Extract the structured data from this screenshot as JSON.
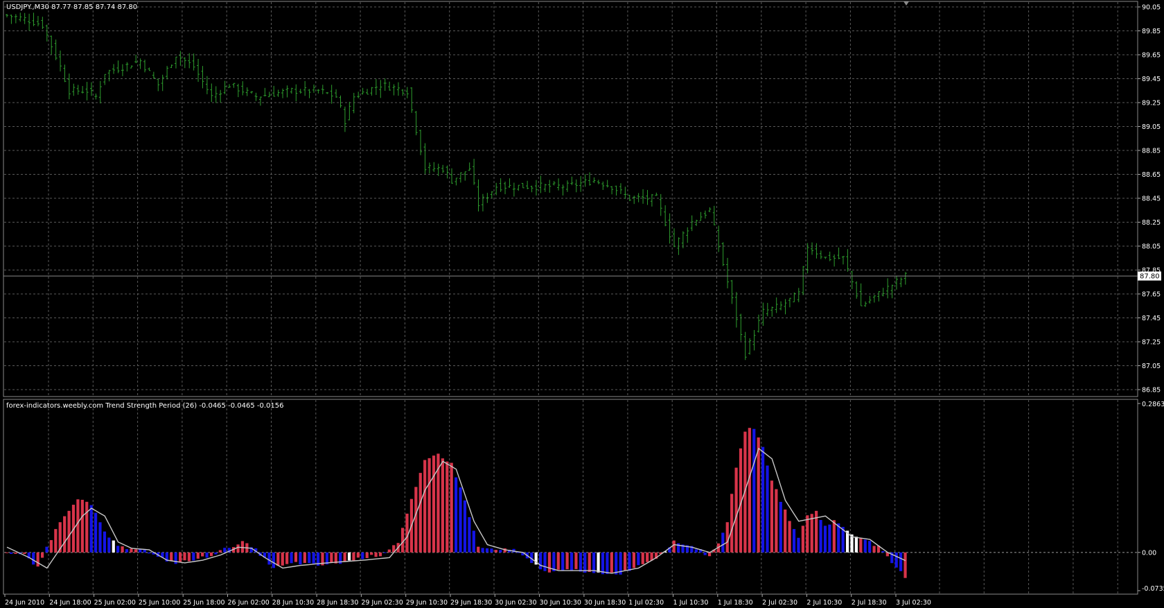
{
  "price_panel": {
    "header": "USDJPY.,M30  87.77 87.85 87.74 87.80",
    "current_price_label": "87.80",
    "y_ticks": [
      "90.05",
      "89.85",
      "89.65",
      "89.45",
      "89.25",
      "89.05",
      "88.85",
      "88.65",
      "88.45",
      "88.25",
      "88.05",
      "87.85",
      "87.65",
      "87.45",
      "87.25",
      "87.05",
      "86.85"
    ]
  },
  "indicator_panel": {
    "header": "forex-indicators.weebly.com Trend Strength Period (26) -0.0465 -0.0465 -0.0156",
    "y_ticks": [
      "0.2863",
      "0.00",
      "-0.0735"
    ]
  },
  "x_ticks": [
    "24 Jun 2010",
    "24 Jun 18:00",
    "25 Jun 02:00",
    "25 Jun 10:00",
    "25 Jun 18:00",
    "26 Jun 02:00",
    "28 Jun 10:30",
    "28 Jun 18:30",
    "29 Jun 02:30",
    "29 Jun 10:30",
    "29 Jun 18:30",
    "30 Jun 02:30",
    "30 Jun 10:30",
    "30 Jun 18:30",
    "1 Jul 02:30",
    "1 Jul 10:30",
    "1 Jul 18:30",
    "2 Jul 02:30",
    "2 Jul 10:30",
    "2 Jul 18:30",
    "3 Jul 02:30"
  ],
  "colors": {
    "background": "#000000",
    "grid": "#5a5a5a",
    "price_bars": "#2e9e2e",
    "hist_positive": "#d8344a",
    "hist_negative": "#1414e6",
    "hist_highlight": "#ffffff",
    "signal_line": "#c8c8c8",
    "axis_text": "#ffffff"
  },
  "chart_data": [
    {
      "type": "line",
      "title": "USDJPY.,M30",
      "ylim": [
        86.85,
        90.05
      ],
      "last_price": 87.8,
      "ohlc_last": {
        "open": 87.77,
        "high": 87.85,
        "low": 87.74,
        "close": 87.8
      },
      "x_index_range": [
        0,
        202
      ],
      "close_keypoints": [
        [
          0,
          89.98
        ],
        [
          4,
          89.95
        ],
        [
          8,
          89.9
        ],
        [
          12,
          89.55
        ],
        [
          14,
          89.35
        ],
        [
          18,
          89.35
        ],
        [
          20,
          89.3
        ],
        [
          22,
          89.5
        ],
        [
          26,
          89.55
        ],
        [
          30,
          89.6
        ],
        [
          34,
          89.4
        ],
        [
          38,
          89.65
        ],
        [
          42,
          89.55
        ],
        [
          46,
          89.3
        ],
        [
          50,
          89.4
        ],
        [
          56,
          89.3
        ],
        [
          64,
          89.35
        ],
        [
          70,
          89.35
        ],
        [
          74,
          89.3
        ],
        [
          76,
          89.1
        ],
        [
          78,
          89.3
        ],
        [
          84,
          89.4
        ],
        [
          90,
          89.35
        ],
        [
          94,
          88.7
        ],
        [
          98,
          88.7
        ],
        [
          100,
          88.6
        ],
        [
          104,
          88.7
        ],
        [
          106,
          88.4
        ],
        [
          110,
          88.55
        ],
        [
          118,
          88.55
        ],
        [
          126,
          88.55
        ],
        [
          132,
          88.6
        ],
        [
          136,
          88.55
        ],
        [
          140,
          88.45
        ],
        [
          146,
          88.45
        ],
        [
          150,
          88.05
        ],
        [
          154,
          88.25
        ],
        [
          158,
          88.35
        ],
        [
          162,
          87.75
        ],
        [
          166,
          87.15
        ],
        [
          170,
          87.5
        ],
        [
          174,
          87.55
        ],
        [
          178,
          87.65
        ],
        [
          180,
          88.05
        ],
        [
          184,
          87.95
        ],
        [
          188,
          87.95
        ],
        [
          190,
          87.75
        ],
        [
          192,
          87.55
        ],
        [
          196,
          87.65
        ],
        [
          200,
          87.75
        ],
        [
          202,
          87.8
        ]
      ]
    },
    {
      "type": "bar",
      "title": "Trend Strength Period (26)",
      "ylim": [
        -0.0735,
        0.2863
      ],
      "current_values": [
        -0.0465,
        -0.0465,
        -0.0156
      ],
      "x_index_range": [
        0,
        202
      ],
      "histogram_keypoints": [
        [
          0,
          0
        ],
        [
          4,
          -0.005
        ],
        [
          7,
          -0.03
        ],
        [
          9,
          0.01
        ],
        [
          12,
          0.06
        ],
        [
          16,
          0.105
        ],
        [
          19,
          0.09
        ],
        [
          22,
          0.04
        ],
        [
          25,
          0.01
        ],
        [
          30,
          0.008
        ],
        [
          34,
          -0.01
        ],
        [
          38,
          -0.02
        ],
        [
          42,
          -0.015
        ],
        [
          46,
          -0.005
        ],
        [
          50,
          0.01
        ],
        [
          53,
          0.02
        ],
        [
          56,
          0.005
        ],
        [
          60,
          -0.03
        ],
        [
          65,
          -0.02
        ],
        [
          70,
          -0.025
        ],
        [
          75,
          -0.02
        ],
        [
          80,
          -0.01
        ],
        [
          84,
          -0.005
        ],
        [
          88,
          0.02
        ],
        [
          91,
          0.1
        ],
        [
          94,
          0.175
        ],
        [
          97,
          0.19
        ],
        [
          100,
          0.17
        ],
        [
          103,
          0.1
        ],
        [
          106,
          0.01
        ],
        [
          110,
          0.005
        ],
        [
          114,
          0.005
        ],
        [
          118,
          -0.02
        ],
        [
          122,
          -0.04
        ],
        [
          126,
          -0.03
        ],
        [
          130,
          -0.04
        ],
        [
          134,
          -0.04
        ],
        [
          138,
          -0.04
        ],
        [
          142,
          -0.025
        ],
        [
          146,
          -0.01
        ],
        [
          150,
          0.02
        ],
        [
          153,
          0.015
        ],
        [
          156,
          0.005
        ],
        [
          158,
          -0.01
        ],
        [
          160,
          0.02
        ],
        [
          162,
          0.06
        ],
        [
          164,
          0.16
        ],
        [
          166,
          0.235
        ],
        [
          168,
          0.24
        ],
        [
          170,
          0.2
        ],
        [
          172,
          0.14
        ],
        [
          174,
          0.1
        ],
        [
          176,
          0.06
        ],
        [
          178,
          0.03
        ],
        [
          180,
          0.07
        ],
        [
          182,
          0.08
        ],
        [
          184,
          0.05
        ],
        [
          186,
          0.06
        ],
        [
          188,
          0.05
        ],
        [
          190,
          0.035
        ],
        [
          192,
          0.03
        ],
        [
          194,
          0.02
        ],
        [
          196,
          0.01
        ],
        [
          198,
          -0.01
        ],
        [
          200,
          -0.03
        ],
        [
          202,
          -0.0465
        ]
      ],
      "signal_keypoints": [
        [
          0,
          0.01
        ],
        [
          5,
          -0.01
        ],
        [
          9,
          -0.03
        ],
        [
          13,
          0.02
        ],
        [
          17,
          0.07
        ],
        [
          19,
          0.085
        ],
        [
          22,
          0.07
        ],
        [
          25,
          0.02
        ],
        [
          28,
          0.008
        ],
        [
          32,
          0.005
        ],
        [
          36,
          -0.015
        ],
        [
          40,
          -0.02
        ],
        [
          44,
          -0.015
        ],
        [
          48,
          -0.005
        ],
        [
          52,
          0.01
        ],
        [
          55,
          0.008
        ],
        [
          58,
          -0.01
        ],
        [
          62,
          -0.03
        ],
        [
          66,
          -0.025
        ],
        [
          72,
          -0.02
        ],
        [
          80,
          -0.015
        ],
        [
          86,
          -0.01
        ],
        [
          90,
          0.03
        ],
        [
          94,
          0.12
        ],
        [
          98,
          0.175
        ],
        [
          101,
          0.16
        ],
        [
          105,
          0.06
        ],
        [
          108,
          0.015
        ],
        [
          112,
          0.005
        ],
        [
          116,
          0.0
        ],
        [
          120,
          -0.025
        ],
        [
          124,
          -0.035
        ],
        [
          128,
          -0.035
        ],
        [
          132,
          -0.035
        ],
        [
          136,
          -0.04
        ],
        [
          142,
          -0.03
        ],
        [
          146,
          -0.01
        ],
        [
          150,
          0.015
        ],
        [
          154,
          0.01
        ],
        [
          158,
          0.0
        ],
        [
          162,
          0.02
        ],
        [
          166,
          0.12
        ],
        [
          169,
          0.2
        ],
        [
          172,
          0.18
        ],
        [
          175,
          0.1
        ],
        [
          178,
          0.06
        ],
        [
          181,
          0.065
        ],
        [
          184,
          0.07
        ],
        [
          187,
          0.05
        ],
        [
          190,
          0.03
        ],
        [
          194,
          0.025
        ],
        [
          198,
          0.0
        ],
        [
          202,
          -0.0156
        ]
      ],
      "highlight_bar_indices": [
        24,
        77,
        119,
        133,
        148,
        189,
        190,
        191
      ]
    }
  ]
}
